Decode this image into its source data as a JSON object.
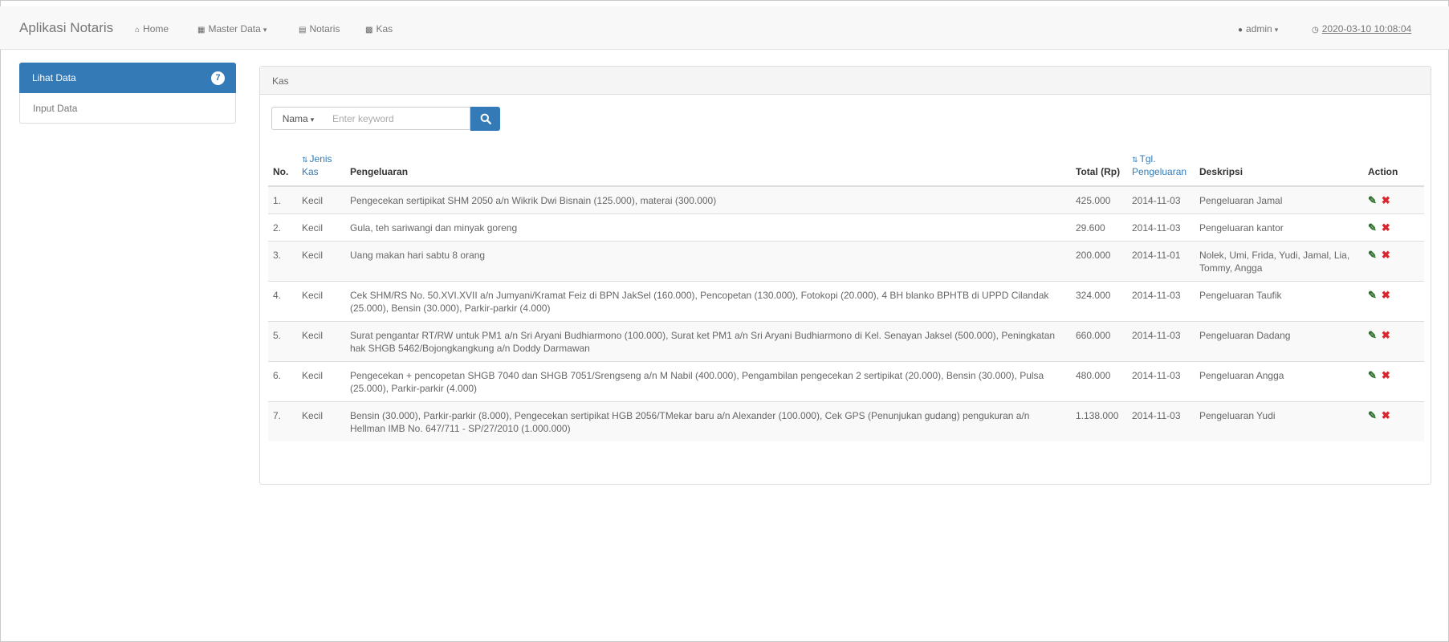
{
  "navbar": {
    "brand": "Aplikasi Notaris",
    "home": "Home",
    "master_data": "Master Data",
    "notaris": "Notaris",
    "kas": "Kas",
    "user": "admin",
    "datetime": "2020-03-10 10:08:04"
  },
  "sidebar": {
    "items": [
      {
        "label": "Lihat Data",
        "badge": "7"
      },
      {
        "label": "Input Data"
      }
    ]
  },
  "panel": {
    "title": "Kas",
    "search": {
      "filter_label": "Nama",
      "placeholder": "Enter keyword"
    },
    "table": {
      "headers": {
        "no": "No.",
        "jenis": "Jenis Kas",
        "pengeluaran": "Pengeluaran",
        "total": "Total (Rp)",
        "tgl": "Tgl. Pengeluaran",
        "deskripsi": "Deskripsi",
        "action": "Action"
      },
      "rows": [
        {
          "no": "1.",
          "jenis": "Kecil",
          "pengeluaran": "Pengecekan sertipikat SHM 2050 a/n Wikrik Dwi Bisnain (125.000), materai (300.000)",
          "total": "425.000",
          "tgl": "2014-11-03",
          "deskripsi": "Pengeluaran Jamal"
        },
        {
          "no": "2.",
          "jenis": "Kecil",
          "pengeluaran": "Gula, teh sariwangi dan minyak goreng",
          "total": "29.600",
          "tgl": "2014-11-03",
          "deskripsi": "Pengeluaran kantor"
        },
        {
          "no": "3.",
          "jenis": "Kecil",
          "pengeluaran": "Uang makan hari sabtu 8 orang",
          "total": "200.000",
          "tgl": "2014-11-01",
          "deskripsi": "Nolek, Umi, Frida, Yudi, Jamal, Lia, Tommy, Angga"
        },
        {
          "no": "4.",
          "jenis": "Kecil",
          "pengeluaran": "Cek SHM/RS No. 50.XVI.XVII a/n Jumyani/Kramat Feiz di BPN JakSel (160.000), Pencopetan (130.000), Fotokopi (20.000), 4 BH blanko BPHTB di UPPD Cilandak (25.000), Bensin (30.000), Parkir-parkir (4.000)",
          "total": "324.000",
          "tgl": "2014-11-03",
          "deskripsi": "Pengeluaran Taufik"
        },
        {
          "no": "5.",
          "jenis": "Kecil",
          "pengeluaran": "Surat pengantar RT/RW untuk PM1 a/n Sri Aryani Budhiarmono (100.000), Surat ket PM1 a/n Sri Aryani Budhiarmono di Kel. Senayan Jaksel (500.000), Peningkatan hak SHGB 5462/Bojongkangkung a/n Doddy Darmawan",
          "total": "660.000",
          "tgl": "2014-11-03",
          "deskripsi": "Pengeluaran Dadang"
        },
        {
          "no": "6.",
          "jenis": "Kecil",
          "pengeluaran": "Pengecekan + pencopetan SHGB 7040 dan SHGB 7051/Srengseng a/n M Nabil (400.000), Pengambilan pengecekan 2 sertipikat (20.000), Bensin (30.000), Pulsa (25.000), Parkir-parkir (4.000)",
          "total": "480.000",
          "tgl": "2014-11-03",
          "deskripsi": "Pengeluaran Angga"
        },
        {
          "no": "7.",
          "jenis": "Kecil",
          "pengeluaran": "Bensin (30.000), Parkir-parkir (8.000), Pengecekan sertipikat HGB 2056/TMekar baru a/n Alexander (100.000), Cek GPS (Penunjukan gudang) pengukuran a/n Hellman IMB No. 647/711 - SP/27/2010 (1.000.000)",
          "total": "1.138.000",
          "tgl": "2014-11-03",
          "deskripsi": "Pengeluaran Yudi"
        }
      ]
    }
  }
}
